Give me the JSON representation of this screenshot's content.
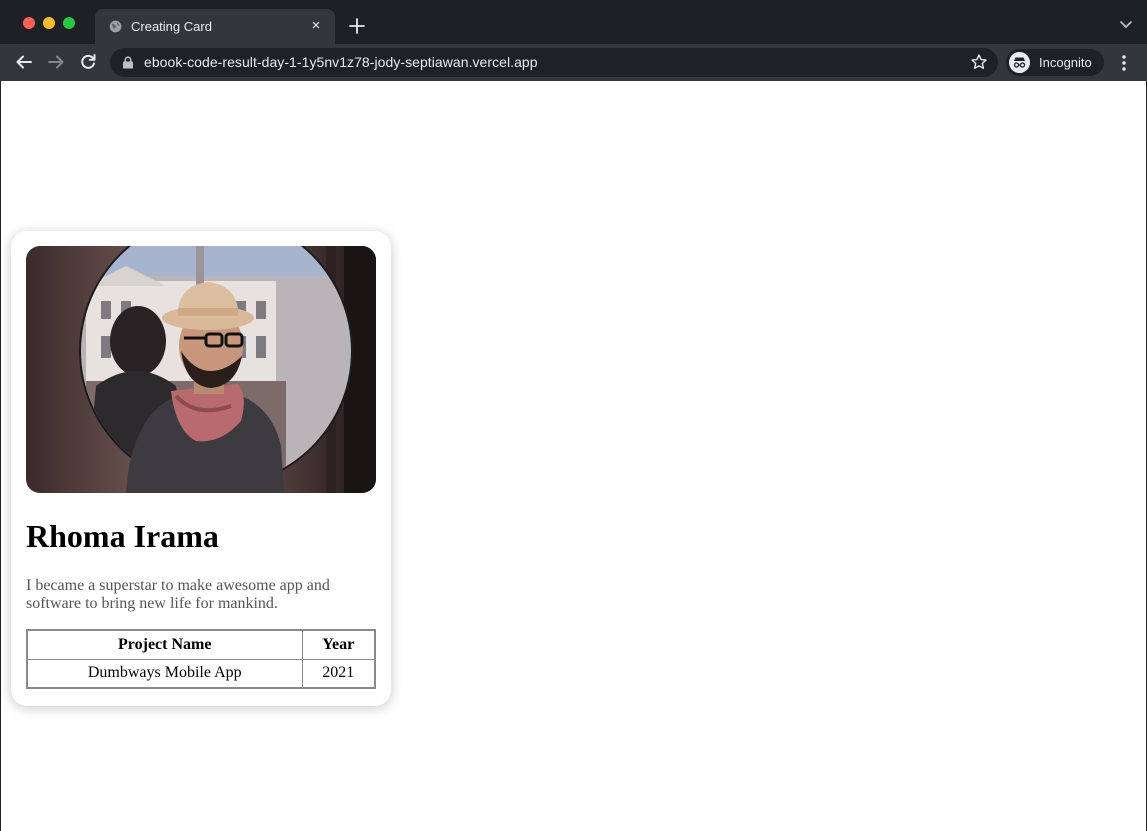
{
  "browser": {
    "tab_title": "Creating Card",
    "tab_close": "×",
    "url": "ebook-code-result-day-1-1y5nv1z78-jody-septiawan.vercel.app",
    "profile_label": "Incognito",
    "icons": [
      "globe-icon",
      "close-icon",
      "plus-icon",
      "chevron-down-icon",
      "back-arrow-icon",
      "forward-arrow-icon",
      "reload-icon",
      "lock-icon",
      "star-icon",
      "incognito-icon",
      "kebab-menu-icon"
    ]
  },
  "card": {
    "image_alt": "Man wearing a hat, glasses and a pink scarf beside a round mirror",
    "name": "Rhoma Irama",
    "bio": "I became a superstar to make awesome app and software to bring new life for mankind.",
    "table": {
      "headers": [
        "Project Name",
        "Year"
      ],
      "rows": [
        [
          "Dumbways Mobile App",
          "2021"
        ]
      ]
    }
  }
}
